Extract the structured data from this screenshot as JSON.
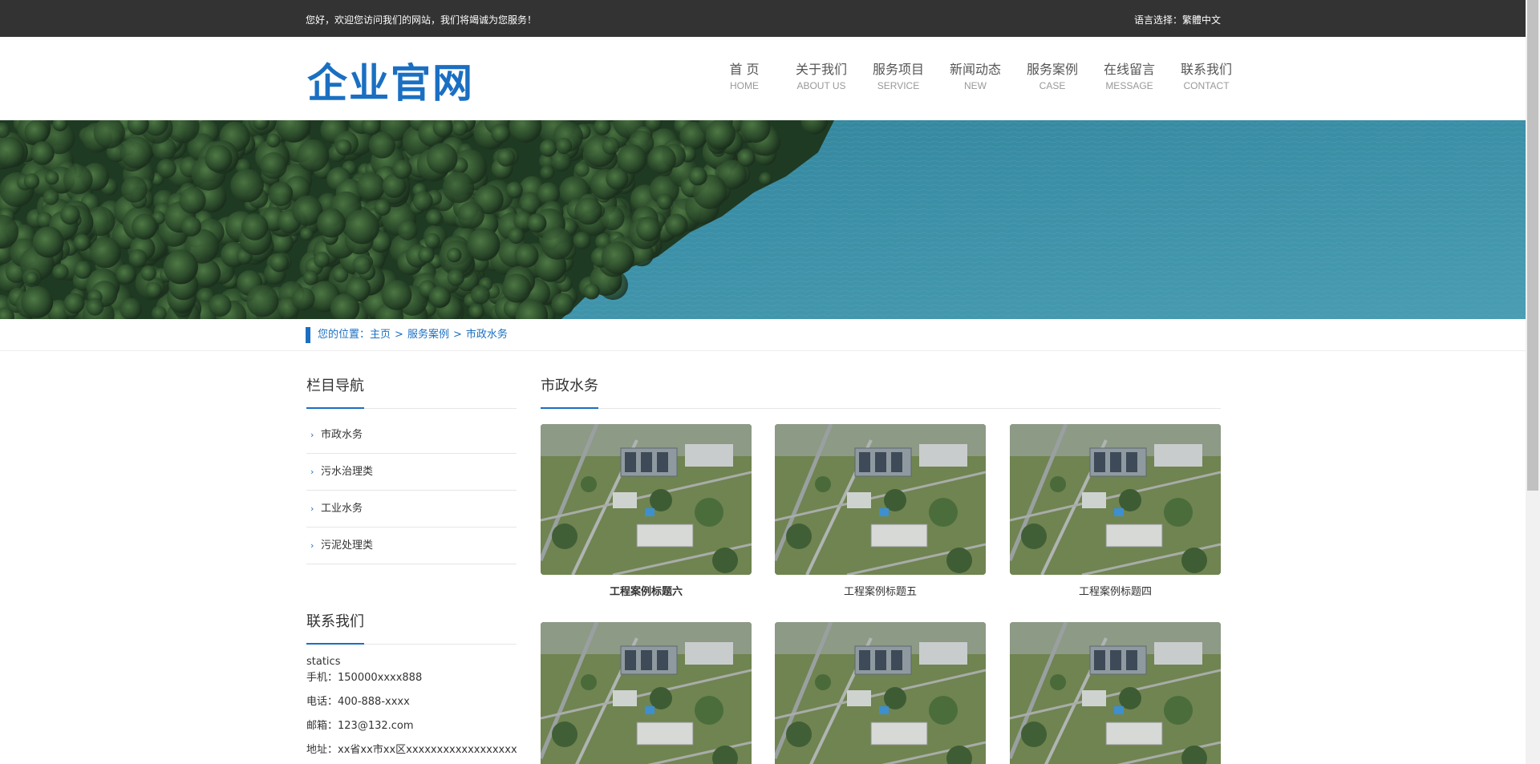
{
  "topbar": {
    "welcome": "您好，欢迎您访问我们的网站，我们将竭诚为您服务！",
    "lang_label": "语言选择：",
    "lang_link": "繁體中文"
  },
  "header": {
    "logo": "企业官网",
    "nav": [
      {
        "cn": "首 页",
        "en": "HOME"
      },
      {
        "cn": "关于我们",
        "en": "ABOUT US"
      },
      {
        "cn": "服务项目",
        "en": "SERVICE"
      },
      {
        "cn": "新闻动态",
        "en": "NEW"
      },
      {
        "cn": "服务案例",
        "en": "CASE"
      },
      {
        "cn": "在线留言",
        "en": "MESSAGE"
      },
      {
        "cn": "联系我们",
        "en": "CONTACT"
      }
    ]
  },
  "breadcrumb": {
    "prefix": "您的位置：",
    "items": [
      "主页",
      "服务案例",
      "市政水务"
    ],
    "sep": ">"
  },
  "sidebar": {
    "nav_title": "栏目导航",
    "items": [
      "市政水务",
      "污水治理类",
      "工业水务",
      "污泥处理类"
    ],
    "contact_title": "联系我们",
    "company": "statics",
    "phone": "手机：150000xxxx888",
    "tel": "电话：400-888-xxxx",
    "email": "邮箱：123@132.com",
    "address": "地址：xx省xx市xx区xxxxxxxxxxxxxxxxxx"
  },
  "main": {
    "title": "市政水务",
    "cases": [
      {
        "title": "工程案例标题六"
      },
      {
        "title": "工程案例标题五"
      },
      {
        "title": "工程案例标题四"
      },
      {
        "title": ""
      },
      {
        "title": ""
      },
      {
        "title": ""
      }
    ]
  },
  "colors": {
    "accent": "#1a6fc2",
    "topbar": "#333333"
  }
}
